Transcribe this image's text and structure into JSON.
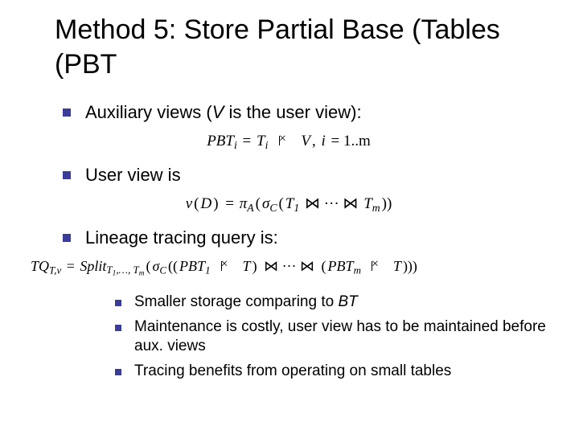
{
  "title": "Method 5: Store Partial Base (Tables (PBT",
  "bullets": {
    "aux_pre": "Auxiliary views (",
    "aux_var": "V",
    "aux_post": " is the user view):",
    "userview": "User view is",
    "lineage": "Lineage tracing query is:"
  },
  "formulas": {
    "pbt_lhs": "PBT",
    "pbt_i": "i",
    "eq": " = ",
    "T": "T",
    "V": "V",
    "comma": ", ",
    "i_lbl": "i",
    "range": " = 1..m",
    "v": "v",
    "D": "D",
    "pi": "π",
    "A": "A",
    "sigma": "σ",
    "C": "C",
    "one": "1",
    "m": "m",
    "dots": " ⋈ ··· ⋈ ",
    "TQ": "TQ",
    "Tv": "T,v",
    "Split": "Split",
    "split_sub_pre": "T",
    "split_sub_1": "1",
    "split_sub_dots": ",…, ",
    "split_sub_m": "m",
    "PBT": "PBT"
  },
  "sub": {
    "s1_pre": "Smaller storage comparing to ",
    "s1_em": "BT",
    "s2": "Maintenance is costly, user view has to be maintained before aux. views",
    "s3": "Tracing benefits from operating on small tables"
  }
}
